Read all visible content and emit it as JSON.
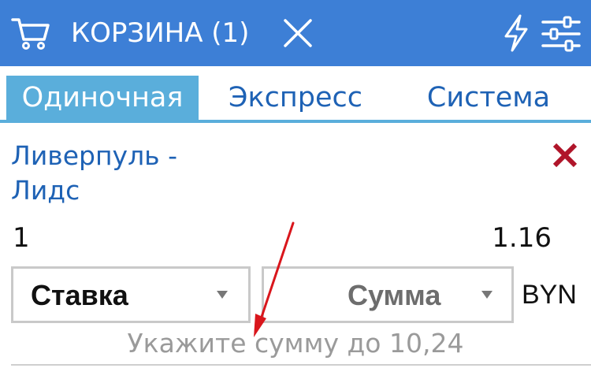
{
  "header": {
    "title": "КОРЗИНА (1)",
    "icons": [
      "cart-icon",
      "close-icon",
      "lightning-icon",
      "filter-sliders-icon"
    ],
    "background": "#3d7fd6"
  },
  "tabs": [
    {
      "label": "Одиночная",
      "active": true
    },
    {
      "label": "Экспресс",
      "active": false
    },
    {
      "label": "Система",
      "active": false
    }
  ],
  "bet": {
    "match": "Ливерпуль - Лидс",
    "outcome": "1",
    "coefficient": "1.16"
  },
  "stake": {
    "select_label": "Ставка",
    "amount_placeholder": "Сумма",
    "currency": "BYN",
    "hint": "Укажите сумму до 10,24"
  },
  "colors": {
    "accent": "#3d7fd6",
    "tab_active": "#5aaedb",
    "link": "#1e62b5",
    "remove": "#b0152a",
    "annotation_arrow": "#d9161c"
  }
}
